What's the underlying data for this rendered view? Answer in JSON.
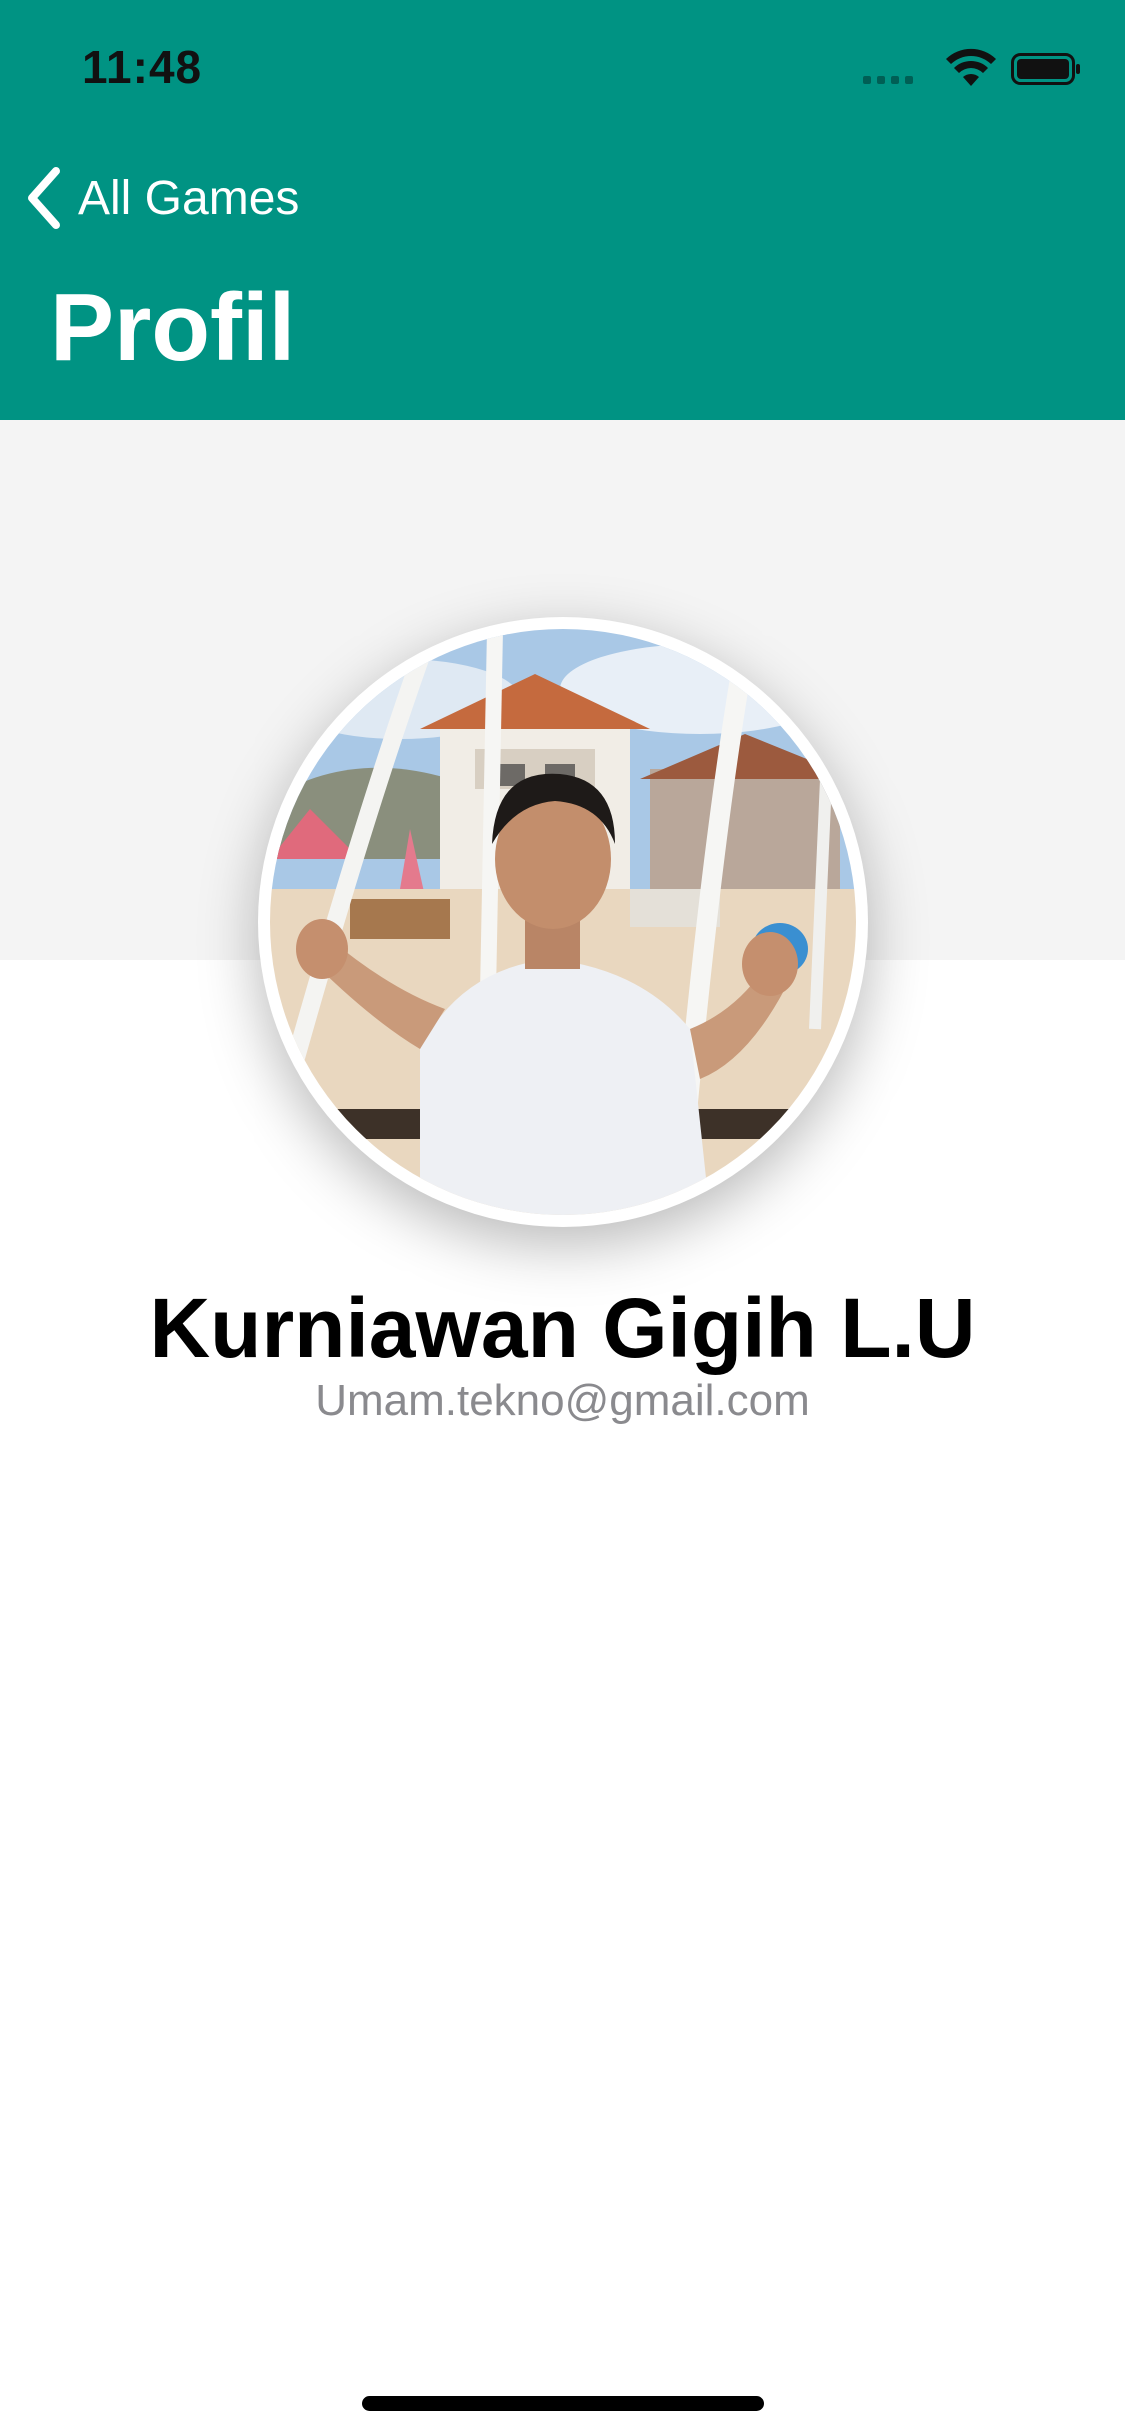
{
  "status_bar": {
    "time": "11:48",
    "icons": [
      "signal-icon",
      "wifi-icon",
      "battery-icon"
    ]
  },
  "nav": {
    "back_label": "All Games",
    "title": "Profil"
  },
  "profile": {
    "name": "Kurniawan Gigih L.U",
    "email": "Umam.tekno@gmail.com"
  },
  "colors": {
    "header": "#009383",
    "cover": "#f4f4f4",
    "email_text": "#8a8a8e"
  }
}
